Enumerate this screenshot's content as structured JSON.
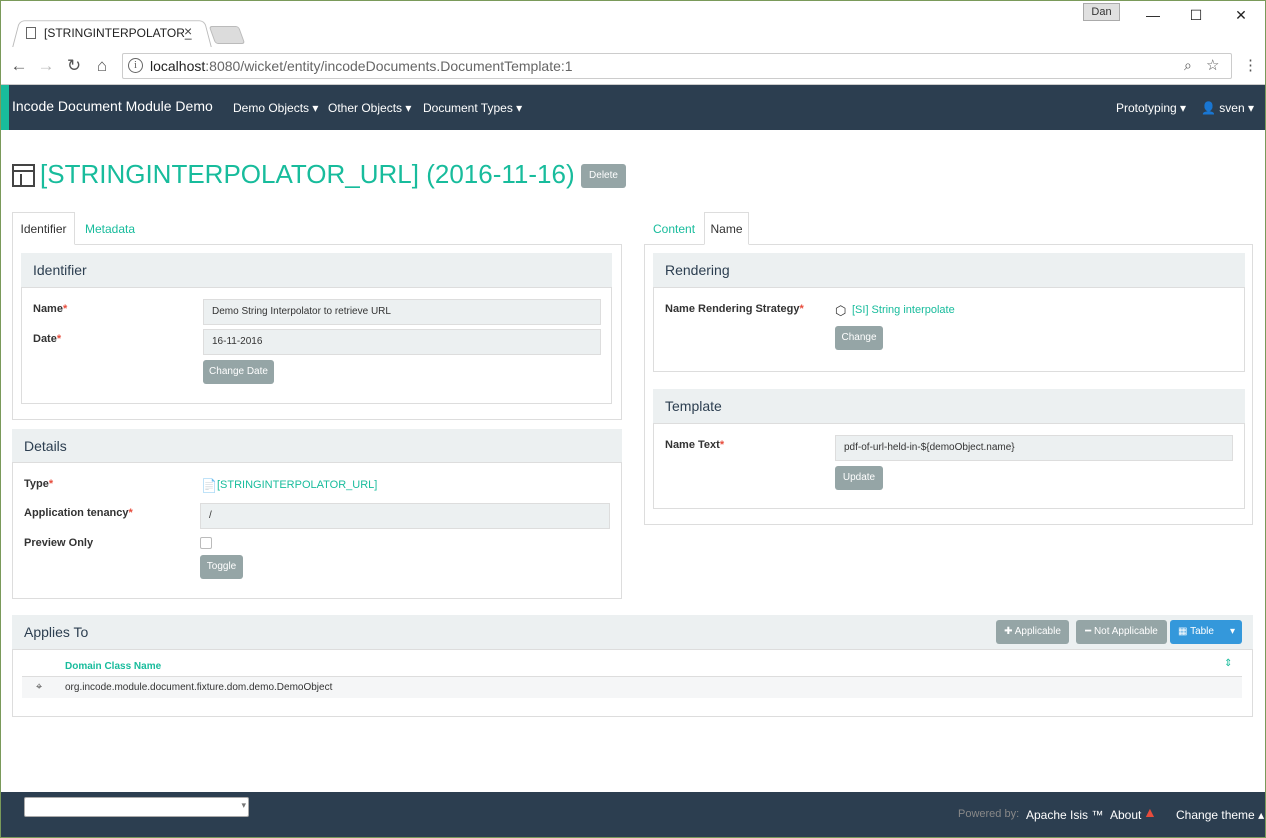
{
  "window": {
    "tab_title": "[STRINGINTERPOLATOR_",
    "tab_close": "×",
    "user_badge": "Dan",
    "minimize": "—",
    "maximize": "☐",
    "close": "✕"
  },
  "address": {
    "host": "localhost",
    "rest": ":8080/wicket/entity/incodeDocuments.DocumentTemplate:1"
  },
  "navbar": {
    "brand": "Incode Document Module Demo",
    "menus": [
      "Demo Objects",
      "Other Objects",
      "Document Types"
    ],
    "right_menus": [
      "Prototyping",
      "sven"
    ]
  },
  "page": {
    "title": "[STRINGINTERPOLATOR_URL] (2016-11-16)",
    "delete_label": "Delete"
  },
  "left_tabs": [
    "Identifier",
    "Metadata"
  ],
  "right_tabs": [
    "Content",
    "Name"
  ],
  "identifier": {
    "heading": "Identifier",
    "name_label": "Name",
    "name_value": "Demo String Interpolator to retrieve URL",
    "date_label": "Date",
    "date_value": "16-11-2016",
    "change_date_label": "Change Date"
  },
  "details": {
    "heading": "Details",
    "type_label": "Type",
    "type_value": "[STRINGINTERPOLATOR_URL]",
    "tenancy_label": "Application tenancy",
    "tenancy_value": "/",
    "preview_label": "Preview Only",
    "toggle_label": "Toggle"
  },
  "rendering": {
    "heading": "Rendering",
    "strategy_label": "Name Rendering Strategy",
    "strategy_value": "[SI] String interpolate",
    "change_label": "Change"
  },
  "template": {
    "heading": "Template",
    "text_label": "Name Text",
    "text_value": "pdf-of-url-held-in-${demoObject.name}",
    "update_label": "Update"
  },
  "applies_to": {
    "heading": "Applies To",
    "applicable_label": "Applicable",
    "not_applicable_label": "Not Applicable",
    "table_label": "Table",
    "column_header": "Domain Class Name",
    "rows": [
      "org.incode.module.document.fixture.dom.demo.DemoObject"
    ]
  },
  "footer": {
    "powered_by": "Powered by:",
    "isis": "Apache Isis ™",
    "about": "About",
    "change_theme": "Change theme"
  },
  "colors": {
    "accent": "#18bc9c",
    "navbar": "#2c3e50",
    "button_grey": "#95a5a6",
    "button_blue": "#3498db",
    "required": "#e74c3c"
  }
}
